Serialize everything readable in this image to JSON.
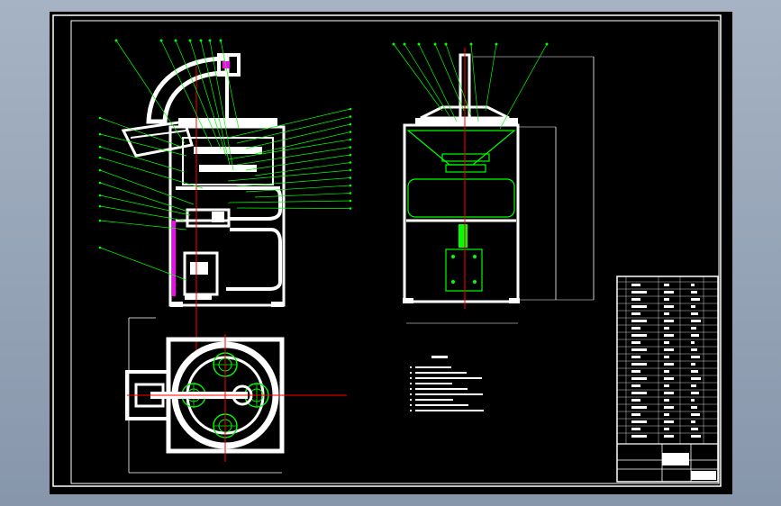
{
  "drawing": {
    "background": "#000000",
    "frame_color": "#ffffff",
    "outline_color": "#ffffff",
    "leader_color": "#00ff00",
    "part_color": "#00ff00",
    "axis_color": "#ff0000",
    "accent_color": "#ff00ff",
    "dim_color": "#ffffff",
    "front_view_labels": 11,
    "right_leaders": 14,
    "side_view_labels": 8
  },
  "title_block": {
    "parts_list_rows": 22,
    "drawing_no": "",
    "sheet_label": ""
  },
  "notes": {
    "lines": []
  }
}
